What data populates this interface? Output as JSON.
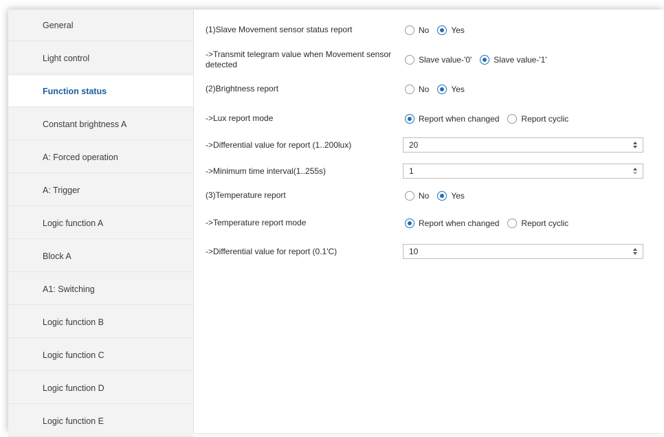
{
  "sidebar": {
    "items": [
      {
        "label": "General"
      },
      {
        "label": "Light control"
      },
      {
        "label": "Function status"
      },
      {
        "label": "Constant brightness A"
      },
      {
        "label": "A: Forced operation"
      },
      {
        "label": "A: Trigger"
      },
      {
        "label": "Logic function A"
      },
      {
        "label": "Block A"
      },
      {
        "label": "A1: Switching"
      },
      {
        "label": "Logic function B"
      },
      {
        "label": "Logic function C"
      },
      {
        "label": "Logic function D"
      },
      {
        "label": "Logic function E"
      }
    ],
    "active_index": 2
  },
  "params": {
    "slave_movement": {
      "label": "(1)Slave Movement sensor status report",
      "opt_no": "No",
      "opt_yes": "Yes",
      "selected": "Yes"
    },
    "transmit_telegram": {
      "label": "->Transmit telegram value when Movement sensor detected",
      "opt_0": "Slave value-'0'",
      "opt_1": "Slave value-'1'",
      "selected": "Slave value-'1'"
    },
    "brightness_report": {
      "label": "(2)Brightness report",
      "opt_no": "No",
      "opt_yes": "Yes",
      "selected": "Yes"
    },
    "lux_mode": {
      "label": "->Lux report mode",
      "opt_changed": "Report when changed",
      "opt_cyclic": "Report cyclic",
      "selected": "Report when changed"
    },
    "lux_diff": {
      "label": "->Differential value for report (1..200lux)",
      "value": "20"
    },
    "min_interval": {
      "label": "->Minimum time interval(1..255s)",
      "value": "1"
    },
    "temperature_report": {
      "label": "(3)Temperature report",
      "opt_no": "No",
      "opt_yes": "Yes",
      "selected": "Yes"
    },
    "temp_mode": {
      "label": "->Temperature report mode",
      "opt_changed": "Report when changed",
      "opt_cyclic": "Report cyclic",
      "selected": "Report when changed"
    },
    "temp_diff": {
      "label": "->Differential value for report (0.1'C)",
      "value": "10"
    }
  },
  "colors": {
    "accent": "#1f6fb8",
    "active_text": "#1a5f9e",
    "sidebar_bg": "#f3f3f3"
  }
}
